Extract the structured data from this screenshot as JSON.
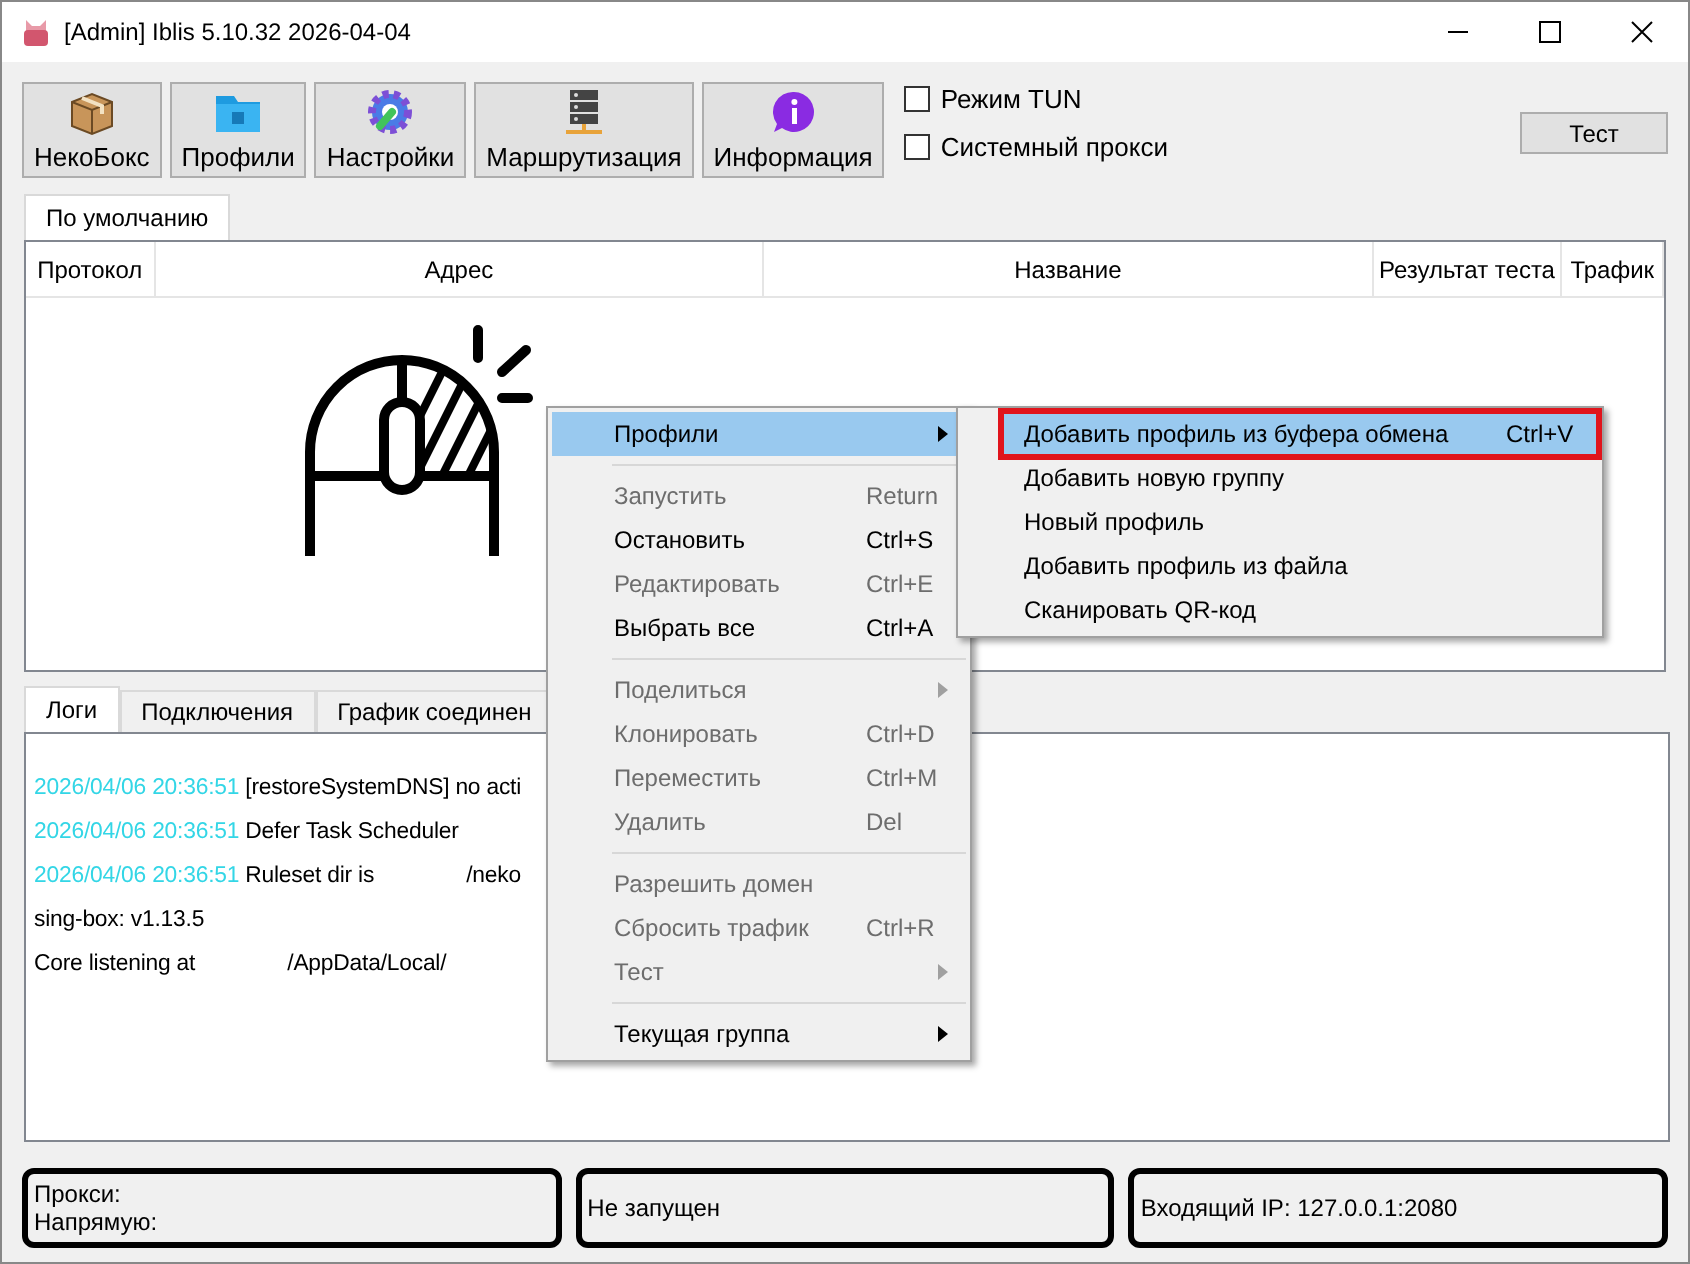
{
  "window": {
    "title": "[Admin] Iblis 5.10.32 2026-04-04"
  },
  "toolbar": {
    "buttons": [
      {
        "label": "НекоБокс"
      },
      {
        "label": "Профили"
      },
      {
        "label": "Настройки"
      },
      {
        "label": "Маршрутизация"
      },
      {
        "label": "Информация"
      }
    ],
    "checkboxes": [
      {
        "label": "Режим TUN",
        "checked": false
      },
      {
        "label": "Системный прокси",
        "checked": false
      }
    ],
    "test_button": "Тест"
  },
  "group_tabs": [
    {
      "label": "По умолчанию",
      "selected": true
    }
  ],
  "table": {
    "columns": [
      "Протокол",
      "Адрес",
      "Название",
      "Результат теста",
      "Трафик"
    ]
  },
  "bottom_tabs": [
    {
      "label": "Логи",
      "selected": true
    },
    {
      "label": "Подключения",
      "selected": false
    },
    {
      "label": "График соединен",
      "selected": false
    }
  ],
  "log": [
    {
      "time": "2026/04/06 20:36:51",
      "parts": [
        "[restoreSystemDNS] no acti"
      ]
    },
    {
      "time": "2026/04/06 20:36:51",
      "parts": [
        "Defer Task Scheduler"
      ]
    },
    {
      "time": "2026/04/06 20:36:51",
      "parts": [
        "Ruleset dir is",
        "/neko"
      ]
    },
    {
      "parts": [
        "sing-box: v1.13.5"
      ]
    },
    {
      "parts": [
        "Core listening at",
        "/AppData/Local/"
      ]
    }
  ],
  "context_menu": {
    "items": [
      {
        "kind": "item",
        "label": "Профили",
        "submenu": true,
        "selected": true,
        "disabled": false
      },
      {
        "kind": "separator"
      },
      {
        "kind": "item",
        "label": "Запустить",
        "shortcut": "Return",
        "disabled": true,
        "selected": false
      },
      {
        "kind": "item",
        "label": "Остановить",
        "shortcut": "Ctrl+S",
        "disabled": false,
        "selected": false
      },
      {
        "kind": "item",
        "label": "Редактировать",
        "shortcut": "Ctrl+E",
        "disabled": true,
        "selected": false
      },
      {
        "kind": "item",
        "label": "Выбрать все",
        "shortcut": "Ctrl+A",
        "disabled": false,
        "selected": false
      },
      {
        "kind": "separator"
      },
      {
        "kind": "item",
        "label": "Поделиться",
        "submenu": true,
        "disabled": true,
        "selected": false
      },
      {
        "kind": "item",
        "label": "Клонировать",
        "shortcut": "Ctrl+D",
        "disabled": true,
        "selected": false
      },
      {
        "kind": "item",
        "label": "Переместить",
        "shortcut": "Ctrl+M",
        "disabled": true,
        "selected": false
      },
      {
        "kind": "item",
        "label": "Удалить",
        "shortcut": "Del",
        "disabled": true,
        "selected": false
      },
      {
        "kind": "separator"
      },
      {
        "kind": "item",
        "label": "Разрешить домен",
        "disabled": true,
        "selected": false
      },
      {
        "kind": "item",
        "label": "Сбросить трафик",
        "shortcut": "Ctrl+R",
        "disabled": true,
        "selected": false
      },
      {
        "kind": "item",
        "label": "Тест",
        "submenu": true,
        "disabled": true,
        "selected": false
      },
      {
        "kind": "separator"
      },
      {
        "kind": "item",
        "label": "Текущая группа",
        "submenu": true,
        "disabled": false,
        "selected": false
      }
    ]
  },
  "submenu": {
    "items": [
      {
        "label": "Добавить профиль из буфера обмена",
        "shortcut": "Ctrl+V",
        "selected": true,
        "outlined": true
      },
      {
        "label": "Добавить новую группу",
        "selected": false,
        "outlined": false
      },
      {
        "label": "Новый профиль",
        "selected": false,
        "outlined": false
      },
      {
        "label": "Добавить профиль из файла",
        "selected": false,
        "outlined": false
      },
      {
        "label": "Сканировать QR-код",
        "selected": false,
        "outlined": false
      }
    ]
  },
  "status_bar": {
    "traffic": [
      "Прокси:",
      "Напрямую:"
    ],
    "state": "Не запущен",
    "inbound": "Входящий IP: 127.0.0.1:2080"
  }
}
